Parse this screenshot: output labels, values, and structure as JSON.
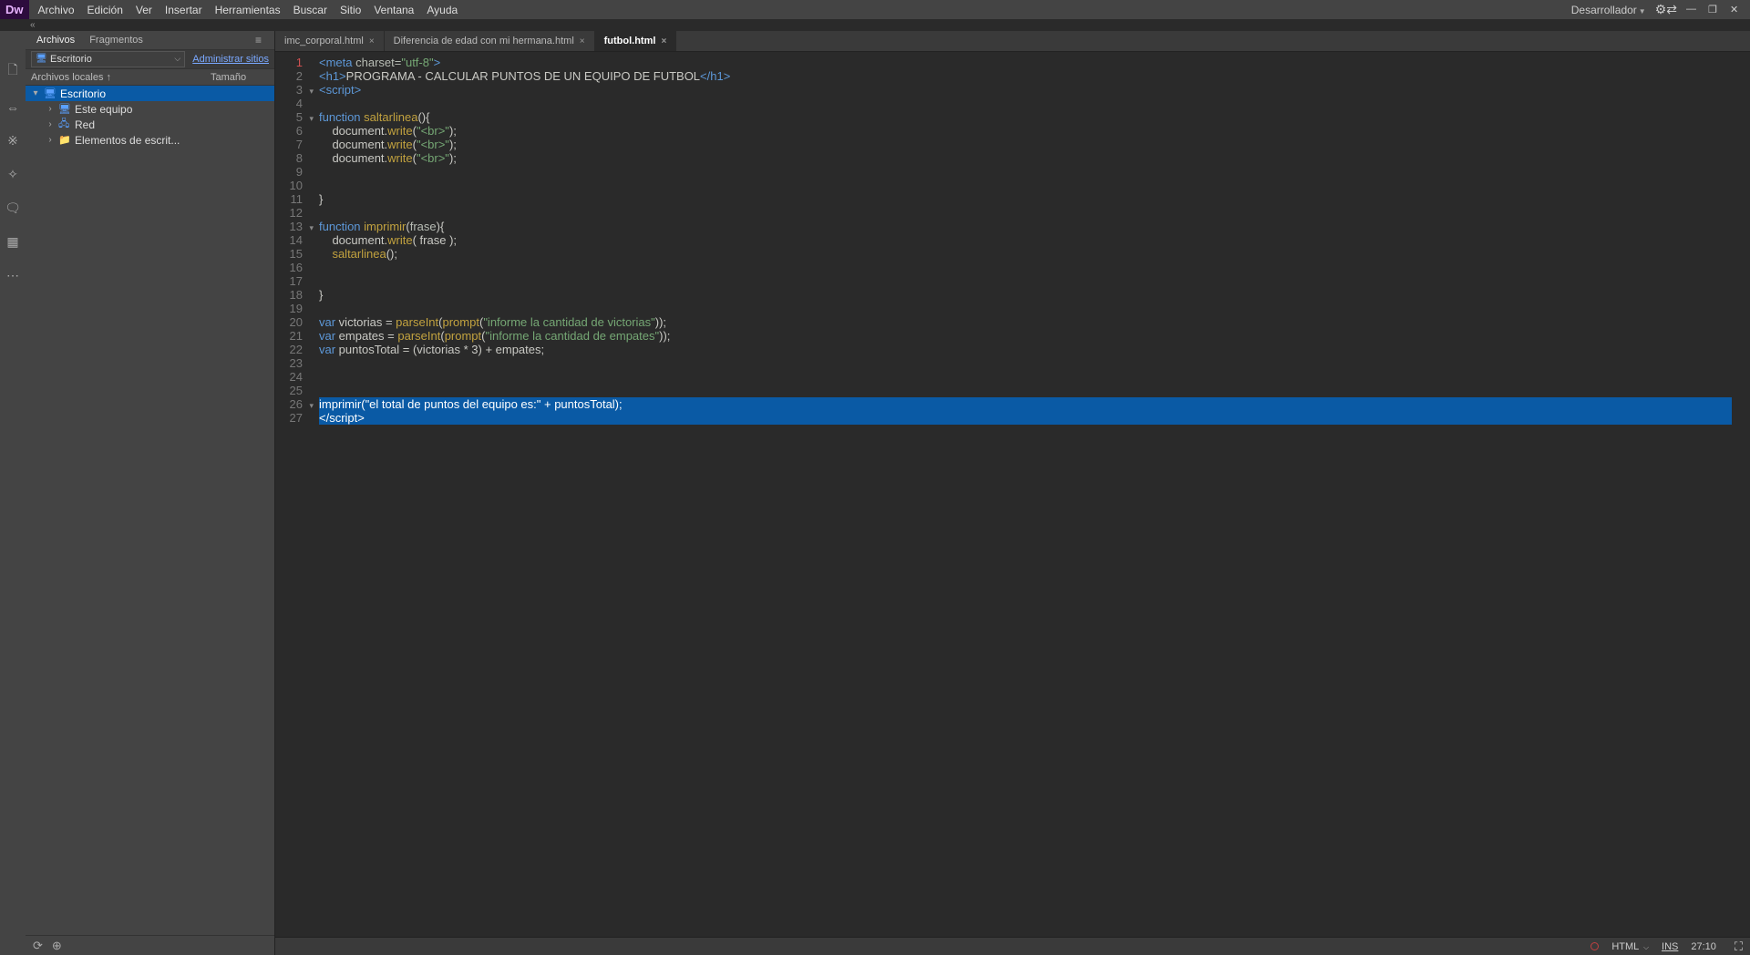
{
  "menubar": {
    "items": [
      "Archivo",
      "Edición",
      "Ver",
      "Insertar",
      "Herramientas",
      "Buscar",
      "Sitio",
      "Ventana",
      "Ayuda"
    ]
  },
  "topbar": {
    "logo": "Dw",
    "workspace": "Desarrollador"
  },
  "railIcons": [
    "new-file-icon",
    "split-icon",
    "link-icon",
    "wand-icon",
    "comment-icon",
    "panel-icon",
    "more-icon"
  ],
  "sidepanel": {
    "tabs": [
      "Archivos",
      "Fragmentos"
    ],
    "dropdown": "Escritorio",
    "adminLink": "Administrar sitios",
    "columns": [
      "Archivos locales ↑",
      "Tamaño"
    ],
    "tree": [
      {
        "depth": 0,
        "exp": "▾",
        "icon": "desktop-ico",
        "label": "Escritorio",
        "sel": true
      },
      {
        "depth": 1,
        "exp": "›",
        "icon": "monitor-ico",
        "label": "Este equipo"
      },
      {
        "depth": 1,
        "exp": "›",
        "icon": "net-ico",
        "label": "Red"
      },
      {
        "depth": 1,
        "exp": "›",
        "icon": "folder-ico",
        "label": "Elementos de escrit..."
      }
    ]
  },
  "fileTabs": [
    {
      "label": "imc_corporal.html",
      "active": false
    },
    {
      "label": "Diferencia de edad con mi hermana.html",
      "active": false
    },
    {
      "label": "futbol.html",
      "active": true
    }
  ],
  "code": {
    "lines": [
      {
        "n": 1,
        "fold": "",
        "tokens": [
          {
            "c": "tag",
            "t": "<meta"
          },
          {
            "c": "attr",
            "t": " charset="
          },
          {
            "c": "str",
            "t": "\"utf-8\""
          },
          {
            "c": "tag",
            "t": ">"
          }
        ]
      },
      {
        "n": 2,
        "fold": "",
        "tokens": [
          {
            "c": "tag",
            "t": "<h1>"
          },
          {
            "c": "txt",
            "t": "PROGRAMA - CALCULAR PUNTOS DE UN EQUIPO DE FUTBOL"
          },
          {
            "c": "tag",
            "t": "</h1>"
          }
        ]
      },
      {
        "n": 3,
        "fold": "▾",
        "tokens": [
          {
            "c": "tag",
            "t": "<script>"
          }
        ]
      },
      {
        "n": 4,
        "fold": "",
        "tokens": []
      },
      {
        "n": 5,
        "fold": "▾",
        "tokens": [
          {
            "c": "kw",
            "t": "function"
          },
          {
            "c": "txt",
            "t": " "
          },
          {
            "c": "fn",
            "t": "saltarlinea"
          },
          {
            "c": "txt",
            "t": "(){"
          }
        ]
      },
      {
        "n": 6,
        "fold": "",
        "tokens": [
          {
            "c": "txt",
            "t": "    document."
          },
          {
            "c": "fn",
            "t": "write"
          },
          {
            "c": "txt",
            "t": "("
          },
          {
            "c": "str",
            "t": "\"<br>\""
          },
          {
            "c": "txt",
            "t": ");"
          }
        ]
      },
      {
        "n": 7,
        "fold": "",
        "tokens": [
          {
            "c": "txt",
            "t": "    document."
          },
          {
            "c": "fn",
            "t": "write"
          },
          {
            "c": "txt",
            "t": "("
          },
          {
            "c": "str",
            "t": "\"<br>\""
          },
          {
            "c": "txt",
            "t": ");"
          }
        ]
      },
      {
        "n": 8,
        "fold": "",
        "tokens": [
          {
            "c": "txt",
            "t": "    document."
          },
          {
            "c": "fn",
            "t": "write"
          },
          {
            "c": "txt",
            "t": "("
          },
          {
            "c": "str",
            "t": "\"<br>\""
          },
          {
            "c": "txt",
            "t": ");"
          }
        ]
      },
      {
        "n": 9,
        "fold": "",
        "tokens": []
      },
      {
        "n": 10,
        "fold": "",
        "tokens": []
      },
      {
        "n": 11,
        "fold": "",
        "tokens": [
          {
            "c": "txt",
            "t": "}"
          }
        ]
      },
      {
        "n": 12,
        "fold": "",
        "tokens": []
      },
      {
        "n": 13,
        "fold": "▾",
        "tokens": [
          {
            "c": "kw",
            "t": "function"
          },
          {
            "c": "txt",
            "t": " "
          },
          {
            "c": "fn",
            "t": "imprimir"
          },
          {
            "c": "txt",
            "t": "("
          },
          {
            "c": "id",
            "t": "frase"
          },
          {
            "c": "txt",
            "t": "){"
          }
        ]
      },
      {
        "n": 14,
        "fold": "",
        "tokens": [
          {
            "c": "txt",
            "t": "    document."
          },
          {
            "c": "fn",
            "t": "write"
          },
          {
            "c": "txt",
            "t": "( frase );"
          }
        ]
      },
      {
        "n": 15,
        "fold": "",
        "tokens": [
          {
            "c": "txt",
            "t": "    "
          },
          {
            "c": "fn",
            "t": "saltarlinea"
          },
          {
            "c": "txt",
            "t": "();"
          }
        ]
      },
      {
        "n": 16,
        "fold": "",
        "tokens": []
      },
      {
        "n": 17,
        "fold": "",
        "tokens": []
      },
      {
        "n": 18,
        "fold": "",
        "tokens": [
          {
            "c": "txt",
            "t": "}"
          }
        ]
      },
      {
        "n": 19,
        "fold": "",
        "tokens": []
      },
      {
        "n": 20,
        "fold": "",
        "tokens": [
          {
            "c": "kw",
            "t": "var"
          },
          {
            "c": "txt",
            "t": " victorias = "
          },
          {
            "c": "fn",
            "t": "parseInt"
          },
          {
            "c": "txt",
            "t": "("
          },
          {
            "c": "fn",
            "t": "prompt"
          },
          {
            "c": "txt",
            "t": "("
          },
          {
            "c": "str",
            "t": "\"informe la cantidad de victorias\""
          },
          {
            "c": "txt",
            "t": "));"
          }
        ]
      },
      {
        "n": 21,
        "fold": "",
        "tokens": [
          {
            "c": "kw",
            "t": "var"
          },
          {
            "c": "txt",
            "t": " empates = "
          },
          {
            "c": "fn",
            "t": "parseInt"
          },
          {
            "c": "txt",
            "t": "("
          },
          {
            "c": "fn",
            "t": "prompt"
          },
          {
            "c": "txt",
            "t": "("
          },
          {
            "c": "str",
            "t": "\"informe la cantidad de empates\""
          },
          {
            "c": "txt",
            "t": "));"
          }
        ]
      },
      {
        "n": 22,
        "fold": "",
        "tokens": [
          {
            "c": "kw",
            "t": "var"
          },
          {
            "c": "txt",
            "t": " puntosTotal = (victorias * 3) + empates;"
          }
        ]
      },
      {
        "n": 23,
        "fold": "",
        "tokens": []
      },
      {
        "n": 24,
        "fold": "",
        "tokens": []
      },
      {
        "n": 25,
        "fold": "",
        "tokens": []
      },
      {
        "n": 26,
        "fold": "▾",
        "sel": true,
        "tokens": [
          {
            "c": "fn",
            "t": "imprimir"
          },
          {
            "c": "txt",
            "t": "("
          },
          {
            "c": "str",
            "t": "\"el total de puntos del equipo es:\""
          },
          {
            "c": "txt",
            "t": " + puntosTotal);"
          }
        ]
      },
      {
        "n": 27,
        "fold": "",
        "sel": true,
        "tokens": [
          {
            "c": "tag",
            "t": "</script>"
          }
        ]
      }
    ]
  },
  "status": {
    "lang": "HTML",
    "ins": "INS",
    "pos": "27:10"
  }
}
